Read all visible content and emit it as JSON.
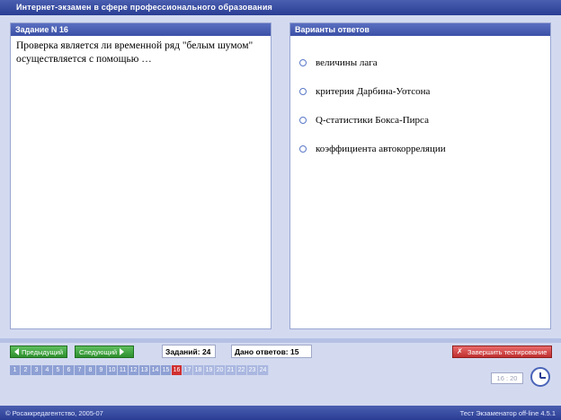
{
  "window": {
    "title": "Интернет-экзамен в сфере профессионального образования"
  },
  "question": {
    "header": "Задание N 16",
    "text": "Проверка является ли временной ряд \"белым шумом\" осуществляется с помощью …"
  },
  "answers": {
    "header": "Варианты ответов",
    "options": [
      "величины лага",
      "критерия Дарбина-Уотсона",
      "Q-статистики Бокса-Пирса",
      "коэффициента автокорреляции"
    ]
  },
  "nav": {
    "prev_label": "Предыдущий",
    "next_label": "Следующий",
    "tasks_label": "Заданий: 24",
    "answered_label": "Дано ответов: 15",
    "finish_label": "Завершить тестирование"
  },
  "pager": {
    "pages": [
      "1",
      "2",
      "3",
      "4",
      "5",
      "6",
      "7",
      "8",
      "9",
      "10",
      "11",
      "12",
      "13",
      "14",
      "15",
      "16",
      "17",
      "18",
      "19",
      "20",
      "21",
      "22",
      "23",
      "24"
    ],
    "current": 16
  },
  "timer": {
    "value": "16 : 20"
  },
  "footer": {
    "left": "© Росаккредагентство, 2005-07",
    "right": "Тест Экзаменатор off-line 4.5.1"
  },
  "colors": {
    "accent": "#2a3d94",
    "current_page": "#d03030",
    "green_button": "#2e8f2e",
    "red_button": "#c03030"
  }
}
